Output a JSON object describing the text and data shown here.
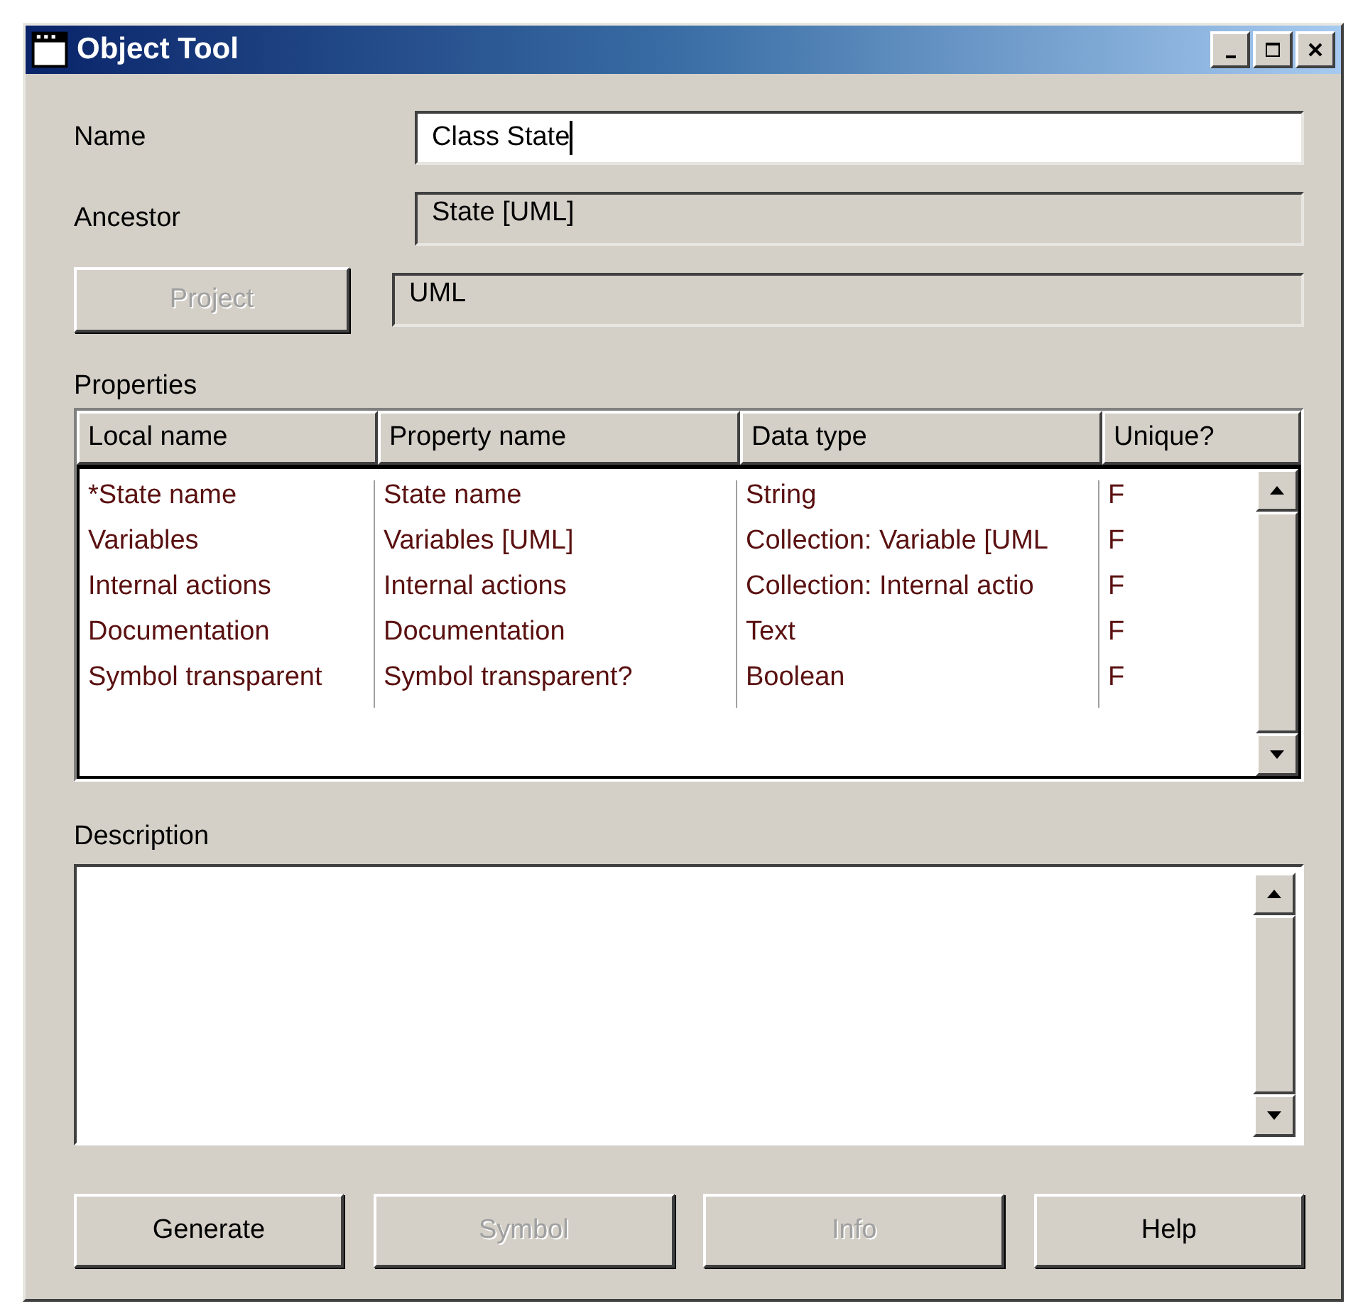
{
  "window": {
    "title": "Object Tool",
    "buttons": [
      {
        "kind": "minimize"
      },
      {
        "kind": "maximize"
      },
      {
        "kind": "close"
      }
    ]
  },
  "fields": [
    {
      "label": "Name",
      "value": "Class State",
      "readonly": false,
      "kind": "label"
    },
    {
      "label": "Ancestor",
      "value": "State [UML]",
      "readonly": true,
      "kind": "label"
    },
    {
      "label": "Project",
      "value": "UML",
      "readonly": true,
      "kind": "button",
      "disabled": true
    }
  ],
  "properties": {
    "label": "Properties",
    "columns": [
      "Local name",
      "Property name",
      "Data type",
      "Unique?"
    ],
    "rows": [
      [
        "*State name",
        "State name",
        "String",
        "F"
      ],
      [
        "Variables",
        "Variables [UML]",
        "Collection: Variable [UML",
        "F"
      ],
      [
        "Internal actions",
        "Internal actions",
        "Collection: Internal actio",
        "F"
      ],
      [
        "Documentation",
        "Documentation",
        "Text",
        "F"
      ],
      [
        "Symbol transparent",
        "Symbol transparent?",
        "Boolean",
        "F"
      ]
    ]
  },
  "description": {
    "label": "Description"
  },
  "buttons": [
    {
      "label": "Generate",
      "disabled": false
    },
    {
      "label": "Symbol",
      "disabled": true
    },
    {
      "label": "Info",
      "disabled": true
    },
    {
      "label": "Help",
      "disabled": false
    }
  ]
}
